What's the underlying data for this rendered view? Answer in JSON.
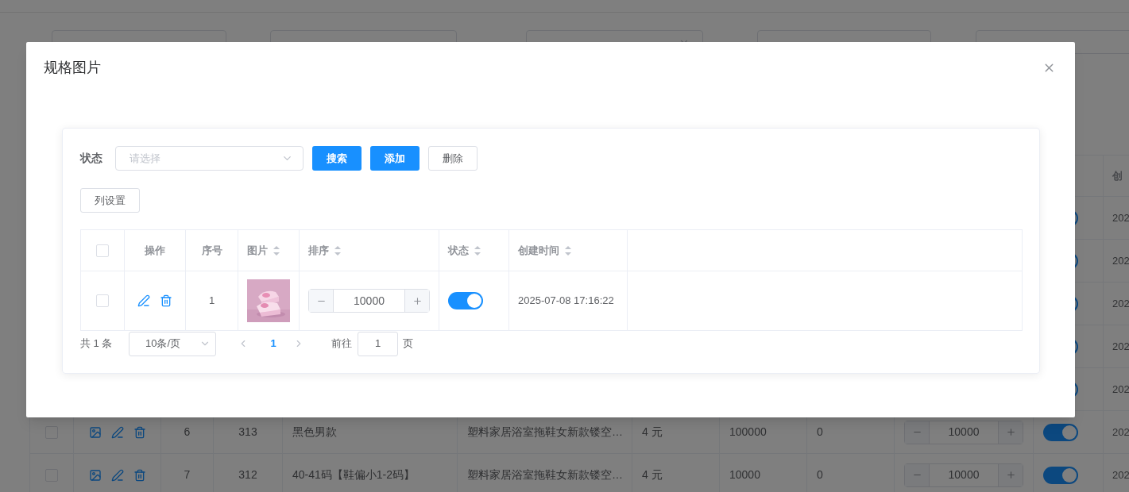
{
  "background": {
    "filters": [
      {
        "kind": "input"
      },
      {
        "kind": "input"
      },
      {
        "kind": "select"
      },
      {
        "kind": "input"
      },
      {
        "kind": "input"
      }
    ],
    "table": {
      "created_header": "创",
      "rows": [
        {
          "kind": "partial",
          "on": true,
          "created": "202"
        },
        {
          "kind": "partial",
          "on": true,
          "created": "202"
        },
        {
          "kind": "partial",
          "on": true,
          "created": "202"
        },
        {
          "kind": "partial",
          "on": true,
          "created": "202"
        },
        {
          "kind": "partial",
          "on": true,
          "created": "202"
        },
        {
          "kind": "full",
          "checked": false,
          "index": "6",
          "id": "313",
          "name": "黑色男款",
          "product": "塑料家居浴室拖鞋女新款镂空…",
          "price": "4 元",
          "stock": "100000",
          "column_9": "0",
          "sort": "10000",
          "on": true,
          "created": "202"
        },
        {
          "kind": "full",
          "checked": false,
          "index": "7",
          "id": "312",
          "name": "40-41码【鞋偏小1-2码】",
          "product": "塑料家居浴室拖鞋女新款镂空…",
          "price": "4 元",
          "stock": "10000",
          "column_9": "0",
          "sort": "10000",
          "on": true,
          "created": "202"
        }
      ]
    }
  },
  "dialog": {
    "title": "规格图片",
    "filter": {
      "label": "状态",
      "placeholder": "请选择"
    },
    "buttons": [
      {
        "label": "搜索",
        "kind": "primary"
      },
      {
        "label": "添加",
        "kind": "primary"
      },
      {
        "label": "删除",
        "kind": "plain"
      }
    ],
    "column_settings": "列设置",
    "table": {
      "all_checked": false,
      "columns": [
        {
          "label": "操作",
          "sortable": false
        },
        {
          "label": "序号",
          "sortable": false
        },
        {
          "label": "图片",
          "sortable": true
        },
        {
          "label": "排序",
          "sortable": true
        },
        {
          "label": "状态",
          "sortable": true
        },
        {
          "label": "创建时间",
          "sortable": true
        }
      ],
      "rows": [
        {
          "checked": false,
          "index": "1",
          "sort": "10000",
          "on": true,
          "created": "2025-07-08 17:16:22"
        }
      ]
    },
    "pagination": {
      "total": "共 1 条",
      "page_size": "10条/页",
      "pages": [
        {
          "label": "1",
          "selected": true
        }
      ],
      "goto_label": "前往",
      "goto_value": "1",
      "goto_suffix": "页"
    }
  }
}
